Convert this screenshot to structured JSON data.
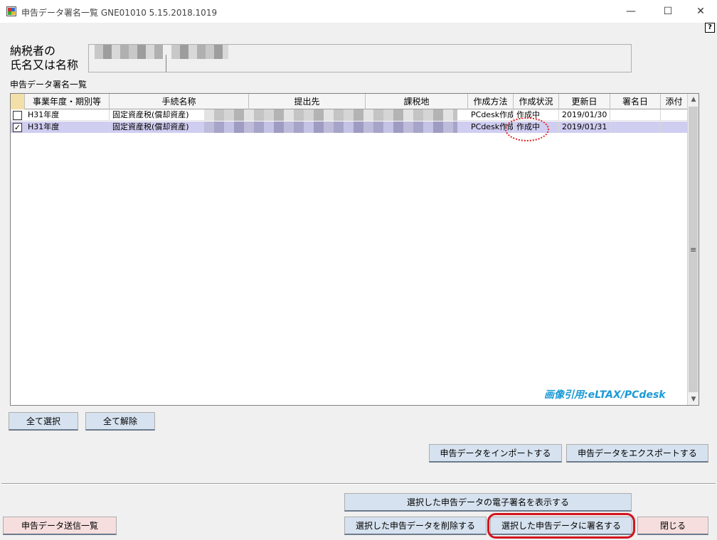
{
  "window": {
    "title": "申告データ署名一覧 GNE01010 5.15.2018.1019",
    "minimize_glyph": "—",
    "maximize_glyph": "☐",
    "close_glyph": "✕"
  },
  "help_glyph": "?",
  "taxpayer": {
    "label_line1": "納税者の",
    "label_line2": "氏名又は名称"
  },
  "list_caption": "申告データ署名一覧",
  "grid": {
    "columns": [
      "事業年度・期別等",
      "手続名称",
      "提出先",
      "課税地",
      "作成方法",
      "作成状況",
      "更新日",
      "署名日",
      "添付"
    ],
    "rows": [
      {
        "checked": false,
        "check_glyph": "",
        "fiscal_year": "H31年度",
        "procedure": "固定資産税(償却資産)",
        "method": "PCdesk作成",
        "status": "作成中",
        "updated": "2019/01/30",
        "signed": ""
      },
      {
        "checked": true,
        "check_glyph": "✓",
        "fiscal_year": "H31年度",
        "procedure": "固定資産税(償却資産)",
        "method": "PCdesk作成",
        "status": "作成中",
        "updated": "2019/01/31",
        "signed": ""
      }
    ]
  },
  "watermark": "画像引用:eLTAX/PCdesk",
  "buttons": {
    "select_all": "全て選択",
    "deselect_all": "全て解除",
    "import": "申告データをインポートする",
    "export": "申告データをエクスポートする",
    "show_signature": "選択した申告データの電子署名を表示する",
    "send_list": "申告データ送信一覧",
    "delete": "選択した申告データを削除する",
    "sign": "選択した申告データに署名する",
    "close": "閉じる"
  },
  "colors": {
    "selected_row": "#cfcdf0",
    "highlight_red": "#d4141e",
    "watermark": "#1a9ad6"
  }
}
